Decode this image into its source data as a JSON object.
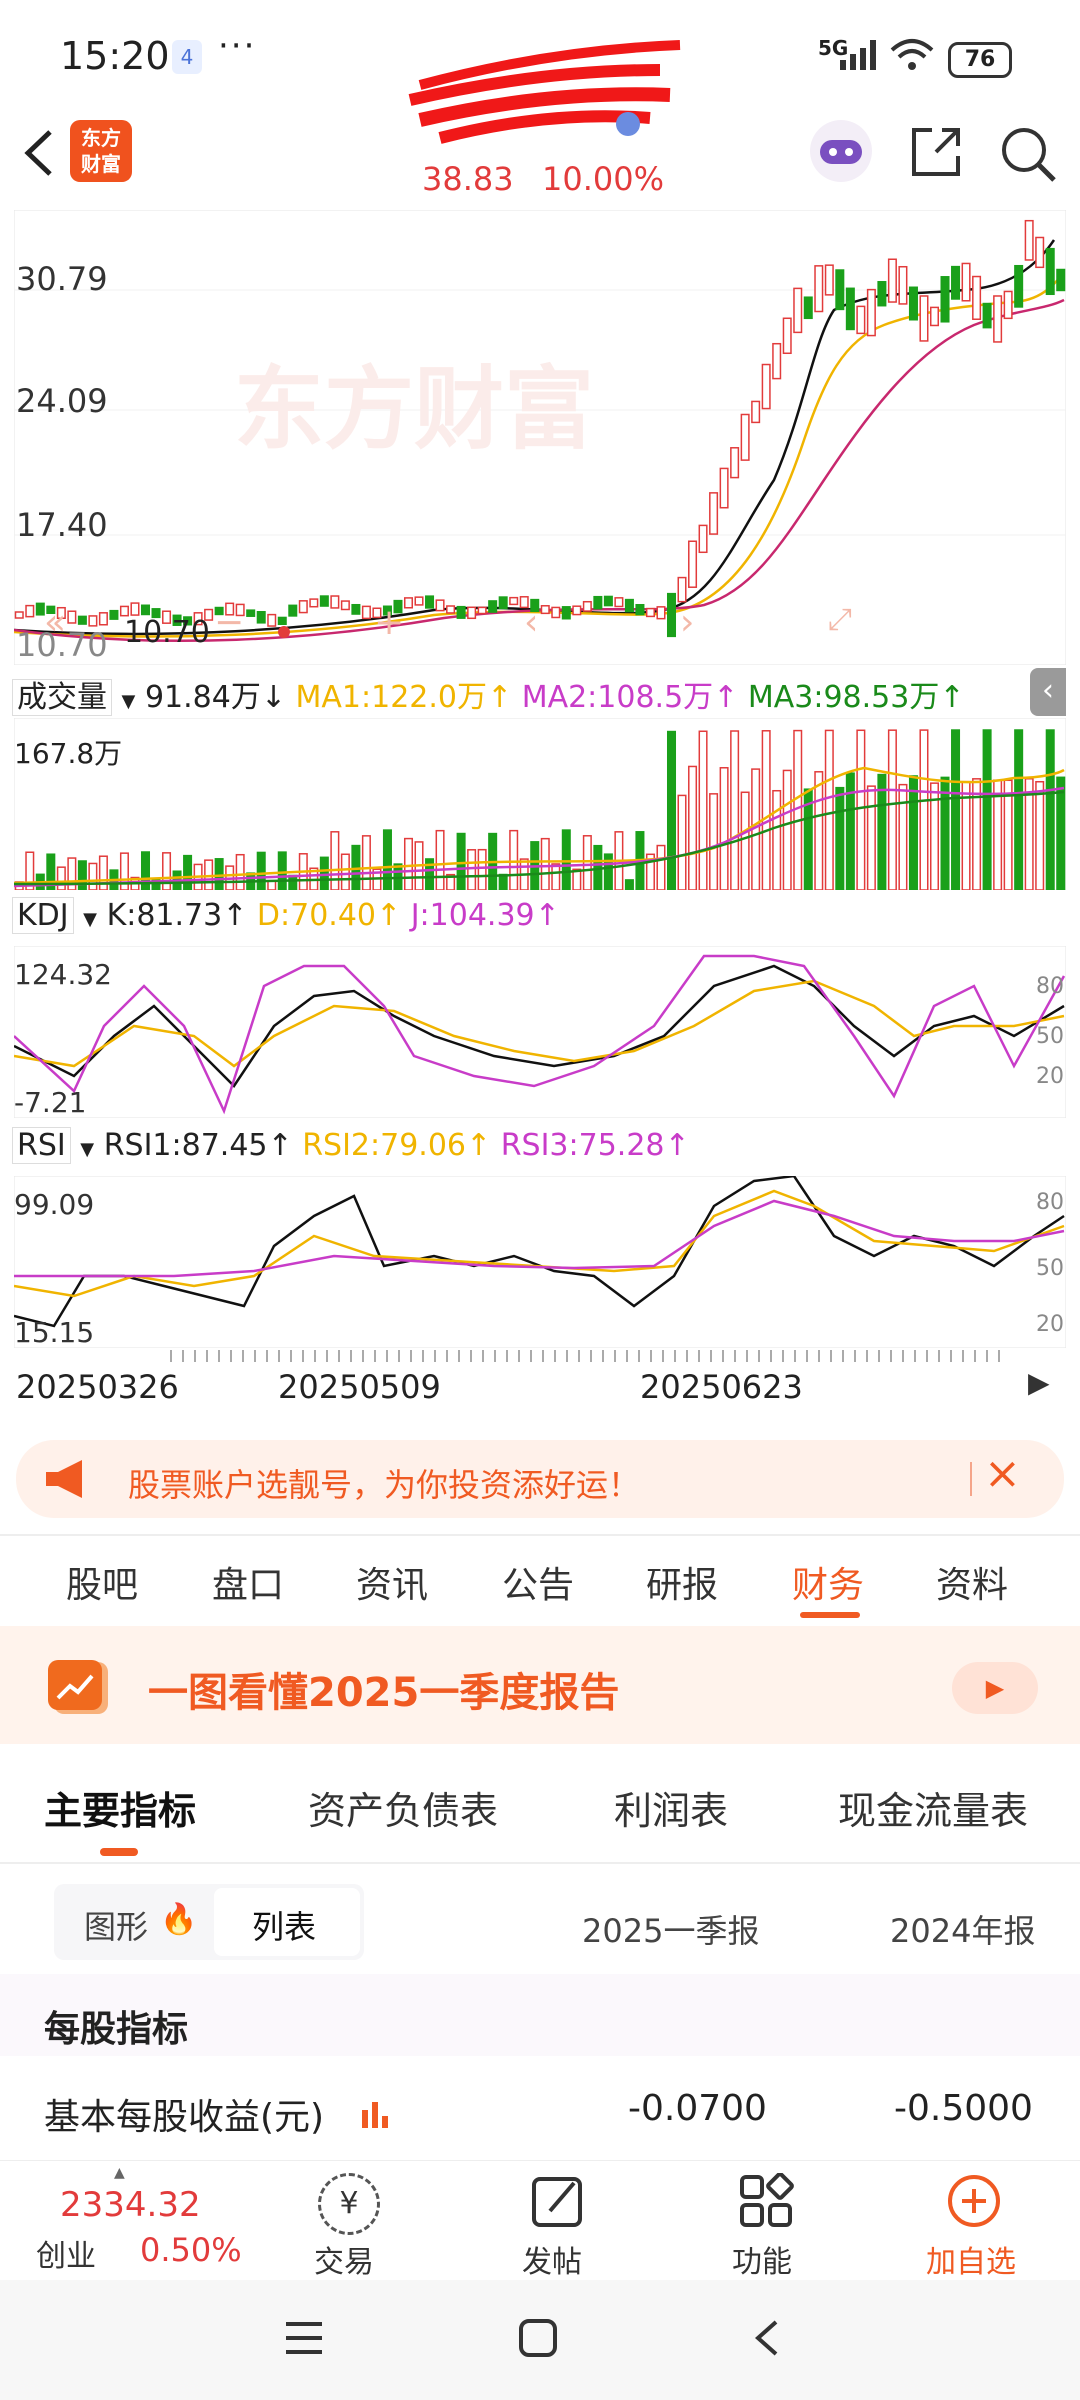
{
  "status": {
    "time": "15:20",
    "notif_count": "4",
    "more": "···",
    "network": "5G",
    "battery": "76"
  },
  "header": {
    "logo_line1": "东方",
    "logo_line2": "财富",
    "price": "38.83",
    "change_pct": "10.00%"
  },
  "kline": {
    "y_ticks": [
      "30.79",
      "24.09",
      "17.40",
      "10.70"
    ],
    "low_marker": "10.70",
    "watermark": "东方财富"
  },
  "volume": {
    "indicator": "成交量",
    "current": "91.84万↓",
    "ma1": "MA1:122.0万↑",
    "ma2": "MA2:108.5万↑",
    "ma3": "MA3:98.53万↑",
    "max_label": "167.8万"
  },
  "kdj": {
    "indicator": "KDJ",
    "k": "K:81.73↑",
    "d": "D:70.40↑",
    "j": "J:104.39↑",
    "top": "124.32",
    "bottom": "-7.21",
    "levels": [
      "80",
      "50",
      "20"
    ]
  },
  "rsi": {
    "indicator": "RSI",
    "rsi1": "RSI1:87.45↑",
    "rsi2": "RSI2:79.06↑",
    "rsi3": "RSI3:75.28↑",
    "top": "99.09",
    "bottom": "15.15",
    "levels": [
      "80",
      "50",
      "20"
    ]
  },
  "dates": [
    "20250326",
    "20250509",
    "20250623"
  ],
  "banner": {
    "text": "股票账户选靓号，为你投资添好运！"
  },
  "tabs": [
    "股吧",
    "盘口",
    "资讯",
    "公告",
    "研报",
    "财务",
    "资料"
  ],
  "report": {
    "title": "一图看懂2025一季度报告"
  },
  "subtabs": [
    "主要指标",
    "资产负债表",
    "利润表",
    "现金流量表"
  ],
  "view_toggle": {
    "graph": "图形",
    "list": "列表"
  },
  "columns": [
    "2025一季报",
    "2024年报"
  ],
  "section": {
    "title": "每股指标"
  },
  "row": {
    "label": "基本每股收益(元)",
    "v1": "-0.0700",
    "v2": "-0.5000"
  },
  "bottom": {
    "index_value": "2334.32",
    "index_name": "创业",
    "index_pct": "0.50%",
    "trade": "交易",
    "post": "发帖",
    "func": "功能",
    "add": "加自选"
  },
  "colors": {
    "up": "#e23b3b",
    "down": "#1aa01a",
    "accent": "#f05a22",
    "ma1": "#f0b400",
    "ma2": "#c83cc8",
    "ma3": "#1a8a1a"
  }
}
